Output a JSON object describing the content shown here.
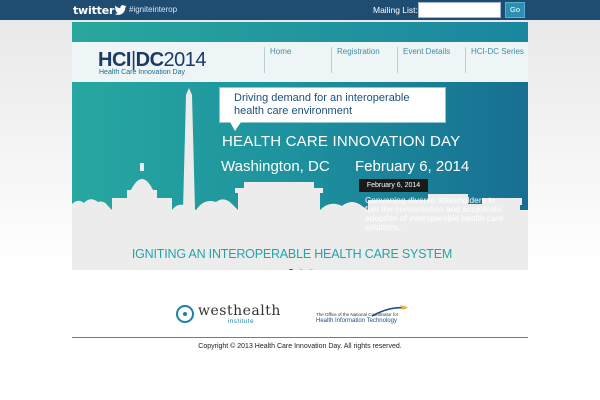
{
  "topbar": {
    "logo_text": "twitter",
    "hashtag": "#igniteinterop",
    "mailing_label": "Mailing List:",
    "mailing_value": "",
    "go_label": "Go"
  },
  "header": {
    "logo_main_a": "HCI",
    "logo_main_sep": "|",
    "logo_main_b": "DC",
    "logo_main_year": "2014",
    "logo_sub": "Health Care Innovation Day",
    "nav": [
      {
        "label": "Home"
      },
      {
        "label": "Registration"
      },
      {
        "label": "Event Details"
      },
      {
        "label": "HCI-DC Series"
      }
    ]
  },
  "hero": {
    "callout": "Driving demand for an interoperable health care environment",
    "title": "HEALTH CARE INNOVATION DAY",
    "location": "Washington, DC",
    "date": "February 6, 2014",
    "caption_date": "February 6, 2014",
    "caption_text": "Convening diverse stakeholders to fuel the conversation and accelerate adoption of interoperable health care solutions.",
    "bottom_title": "IGNITING AN INTEROPERABLE HEALTH CARE SYSTEM",
    "active_slide": 1,
    "slide_count": 3
  },
  "footer": {
    "westhealth_word": "westhealth",
    "westhealth_sub": "institute",
    "onc_small": "The Office of the National Coordinator for",
    "onc_big": "Health Information Technology",
    "copyright": "Copyright © 2013 Health Care Innovation Day. All rights reserved."
  },
  "colors": {
    "topbar": "#1f4d72",
    "teal": "#27a7a0",
    "blue": "#176f92",
    "accent": "#2b95c2"
  }
}
